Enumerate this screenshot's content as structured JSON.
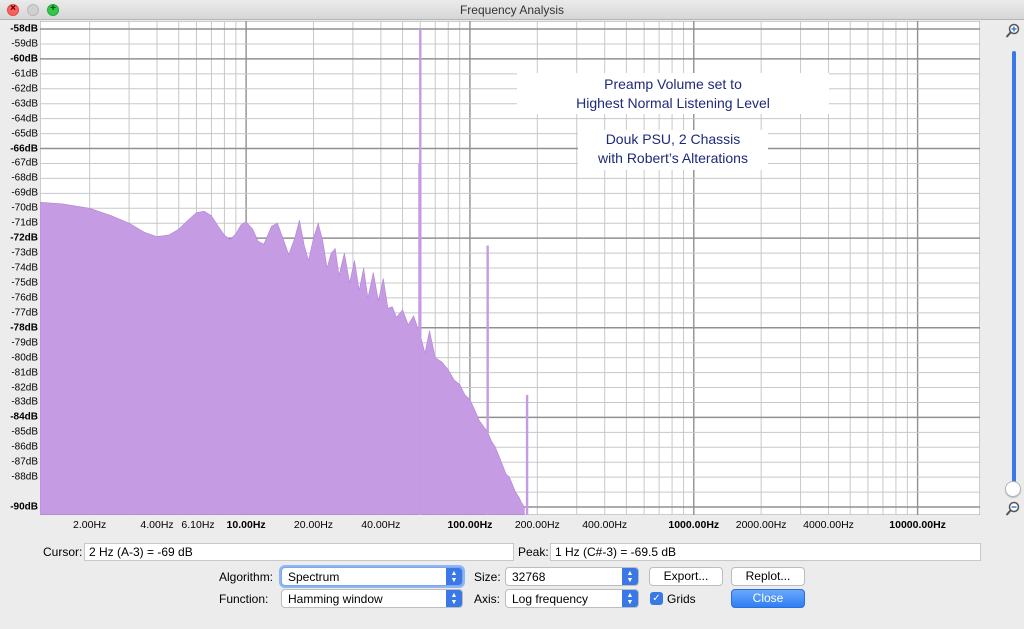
{
  "window": {
    "title": "Frequency Analysis"
  },
  "annotation": {
    "lines1": [
      "Preamp Volume set to",
      "Highest Normal Listening Level"
    ],
    "lines2": [
      "Douk PSU, 2 Chassis",
      "with Robert’s Alterations"
    ]
  },
  "readouts": {
    "cursor_label": "Cursor:",
    "cursor_value": "2 Hz (A-3) = -69 dB",
    "peak_label": "Peak:",
    "peak_value": "1 Hz (C#-3) = -69.5 dB"
  },
  "controls": {
    "algorithm_label": "Algorithm:",
    "algorithm_value": "Spectrum",
    "function_label": "Function:",
    "function_value": "Hamming window",
    "size_label": "Size:",
    "size_value": "32768",
    "axis_label": "Axis:",
    "axis_value": "Log frequency",
    "export_label": "Export...",
    "replot_label": "Replot...",
    "grids_label": "Grids",
    "grids_checked": true,
    "close_label": "Close"
  },
  "chart_data": {
    "type": "area",
    "xscale": "log",
    "ylim": [
      -90,
      -58
    ],
    "xlim": [
      1.2,
      19000
    ],
    "y_ticks": [
      "-58dB",
      "-59dB",
      "-60dB",
      "-61dB",
      "-62dB",
      "-63dB",
      "-64dB",
      "-65dB",
      "-66dB",
      "-67dB",
      "-68dB",
      "-69dB",
      "-70dB",
      "-71dB",
      "-72dB",
      "-73dB",
      "-74dB",
      "-75dB",
      "-76dB",
      "-77dB",
      "-78dB",
      "-79dB",
      "-80dB",
      "-81dB",
      "-82dB",
      "-83dB",
      "-84dB",
      "-85dB",
      "-86dB",
      "-87dB",
      "-88dB",
      "-90dB"
    ],
    "y_major_ticks": [
      "-58dB",
      "-60dB",
      "-66dB",
      "-72dB",
      "-78dB",
      "-84dB",
      "-90dB"
    ],
    "x_ticks": [
      {
        "value": 2,
        "label": "2.00Hz"
      },
      {
        "value": 4,
        "label": "4.00Hz"
      },
      {
        "value": 6.1,
        "label": "6.10Hz"
      },
      {
        "value": 10,
        "label": "10.00Hz",
        "major": true
      },
      {
        "value": 20,
        "label": "20.00Hz"
      },
      {
        "value": 40,
        "label": "40.00Hz"
      },
      {
        "value": 100,
        "label": "100.00Hz",
        "major": true
      },
      {
        "value": 200,
        "label": "200.00Hz"
      },
      {
        "value": 400,
        "label": "400.00Hz"
      },
      {
        "value": 1000,
        "label": "1000.00Hz",
        "major": true
      },
      {
        "value": 2000,
        "label": "2000.00Hz"
      },
      {
        "value": 4000,
        "label": "4000.00Hz"
      },
      {
        "value": 10000,
        "label": "10000.00Hz",
        "major": true
      }
    ],
    "grid": true,
    "fill_color": "#c59be3",
    "spectrum": [
      [
        1.2,
        -69.6
      ],
      [
        1.5,
        -69.7
      ],
      [
        2,
        -70
      ],
      [
        2.5,
        -70.5
      ],
      [
        3,
        -71
      ],
      [
        3.5,
        -71.6
      ],
      [
        4,
        -71.9
      ],
      [
        4.5,
        -71.8
      ],
      [
        5,
        -71.4
      ],
      [
        5.5,
        -70.8
      ],
      [
        6,
        -70.3
      ],
      [
        6.5,
        -70.2
      ],
      [
        7,
        -70.5
      ],
      [
        7.5,
        -71.2
      ],
      [
        8,
        -71.8
      ],
      [
        8.5,
        -72.1
      ],
      [
        9,
        -71.7
      ],
      [
        9.5,
        -71.1
      ],
      [
        10,
        -70.9
      ],
      [
        10.7,
        -71.4
      ],
      [
        11.3,
        -72.2
      ],
      [
        12,
        -72.4
      ],
      [
        13,
        -71.2
      ],
      [
        13.8,
        -71
      ],
      [
        14.6,
        -72
      ],
      [
        15.5,
        -73.1
      ],
      [
        16.5,
        -72
      ],
      [
        17.3,
        -70.8
      ],
      [
        18.2,
        -72.5
      ],
      [
        19,
        -73.5
      ],
      [
        20,
        -72
      ],
      [
        21,
        -71
      ],
      [
        22,
        -72.2
      ],
      [
        23,
        -74
      ],
      [
        24,
        -73
      ],
      [
        25,
        -72.7
      ],
      [
        26,
        -74.5
      ],
      [
        27.5,
        -73
      ],
      [
        29,
        -75
      ],
      [
        30.5,
        -73.5
      ],
      [
        32,
        -75.5
      ],
      [
        33.5,
        -74
      ],
      [
        35,
        -76
      ],
      [
        37,
        -74.3
      ],
      [
        39,
        -76.2
      ],
      [
        41,
        -74.7
      ],
      [
        43,
        -76.7
      ],
      [
        45,
        -76.6
      ],
      [
        47,
        -77.3
      ],
      [
        50,
        -76.8
      ],
      [
        53,
        -77.8
      ],
      [
        56,
        -77.2
      ],
      [
        60,
        -78.5
      ],
      [
        63,
        -79.7
      ],
      [
        66,
        -78.2
      ],
      [
        70,
        -80
      ],
      [
        75,
        -80.3
      ],
      [
        80,
        -80.8
      ],
      [
        85,
        -81.5
      ],
      [
        90,
        -81.8
      ],
      [
        95,
        -82.5
      ],
      [
        100,
        -82.8
      ],
      [
        105,
        -83.5
      ],
      [
        110,
        -84.2
      ],
      [
        115,
        -84.6
      ],
      [
        120,
        -85
      ],
      [
        125,
        -85.6
      ],
      [
        130,
        -86
      ],
      [
        135,
        -86.6
      ],
      [
        140,
        -87.2
      ],
      [
        145,
        -87.8
      ],
      [
        150,
        -88
      ],
      [
        155,
        -88.5
      ],
      [
        160,
        -89
      ],
      [
        165,
        -89.3
      ],
      [
        170,
        -89.7
      ],
      [
        175,
        -90
      ]
    ],
    "peaks": [
      {
        "freq": 60,
        "db": -58
      },
      {
        "freq": 59.5,
        "db": -67
      },
      {
        "freq": 120,
        "db": -72.5
      },
      {
        "freq": 180,
        "db": -82.5
      }
    ]
  }
}
